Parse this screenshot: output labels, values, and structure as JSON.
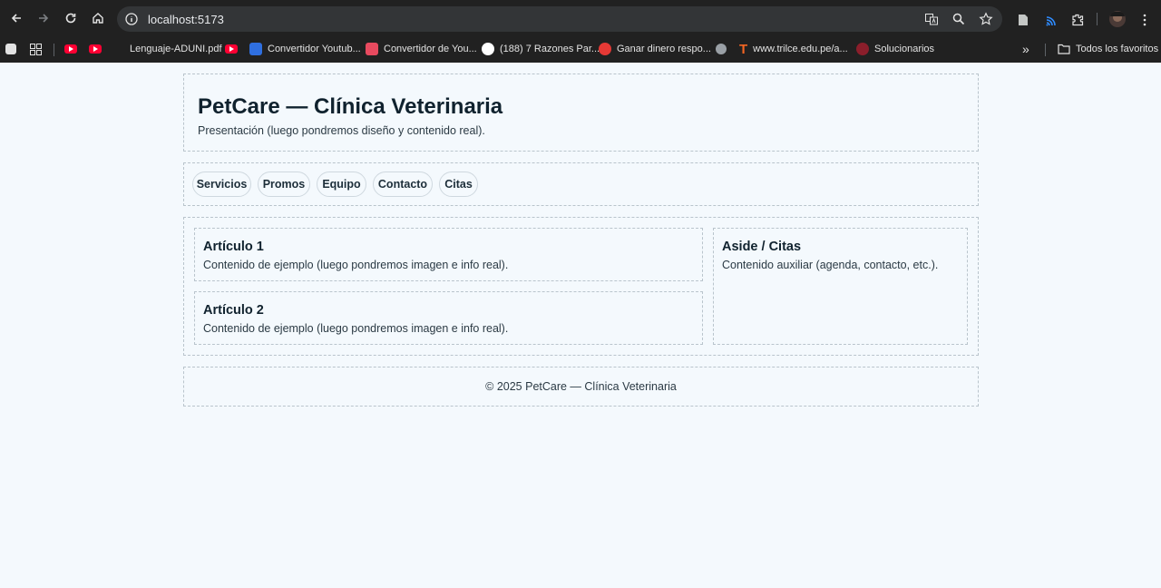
{
  "browser": {
    "url": "localhost:5173",
    "bookmarks": [
      {
        "label": "Lenguaje-ADUNI.pdf"
      },
      {
        "label": "Convertidor Youtub..."
      },
      {
        "label": "Convertidor de You..."
      },
      {
        "label": "(188) 7 Razones Par..."
      },
      {
        "label": "Ganar dinero respo..."
      },
      {
        "label": "www.trilce.edu.pe/a..."
      },
      {
        "label": "Solucionarios"
      }
    ],
    "all_bookmarks_label": "Todos los favoritos",
    "colors": {
      "chrome": "#212121",
      "omnibox": "#333537",
      "youtube": "#ff0033"
    }
  },
  "header": {
    "title": "PetCare — Clínica Veterinaria",
    "subtitle": "Presentación (luego pondremos diseño y contenido real)."
  },
  "nav": {
    "items": [
      {
        "label": "Servicios"
      },
      {
        "label": "Promos"
      },
      {
        "label": "Equipo"
      },
      {
        "label": "Contacto"
      },
      {
        "label": "Citas"
      }
    ]
  },
  "main": {
    "articles": [
      {
        "title": "Artículo 1",
        "body": "Contenido de ejemplo (luego pondremos imagen e info real)."
      },
      {
        "title": "Artículo 2",
        "body": "Contenido de ejemplo (luego pondremos imagen e info real)."
      }
    ],
    "aside": {
      "title": "Aside / Citas",
      "body": "Contenido auxiliar (agenda, contacto, etc.)."
    }
  },
  "footer": {
    "text": "© 2025 PetCare — Clínica Veterinaria"
  },
  "theme": {
    "page_bg": "#f4f9fd",
    "border": "#b9c4cc",
    "text_dark": "#10222e"
  }
}
